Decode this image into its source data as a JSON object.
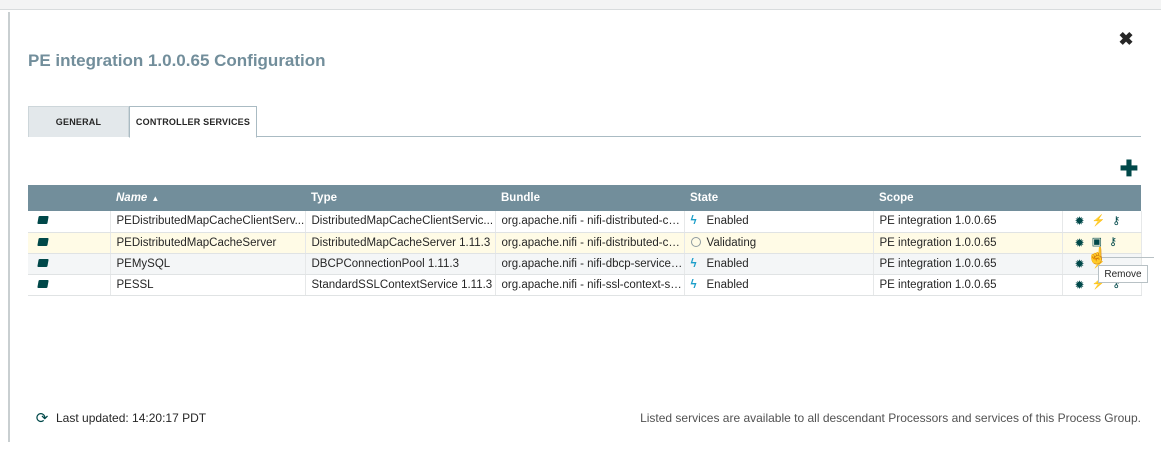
{
  "dialog": {
    "title": "PE integration 1.0.0.65 Configuration",
    "close_glyph": "✖"
  },
  "tabs": [
    {
      "label": "GENERAL",
      "active": false
    },
    {
      "label": "CONTROLLER SERVICES",
      "active": true
    }
  ],
  "add_glyph": "✚",
  "table": {
    "columns": [
      {
        "key": "name",
        "label": "Name",
        "sorted": "asc"
      },
      {
        "key": "type",
        "label": "Type"
      },
      {
        "key": "bundle",
        "label": "Bundle"
      },
      {
        "key": "state",
        "label": "State"
      },
      {
        "key": "scope",
        "label": "Scope"
      }
    ],
    "rows": [
      {
        "name": "PEDistributedMapCacheClientServ...",
        "type": "DistributedMapCacheClientServic...",
        "bundle": "org.apache.nifi - nifi-distributed-ca...",
        "state": "Enabled",
        "state_icon": "lightning-icon",
        "scope": "PE integration 1.0.0.65"
      },
      {
        "name": "PEDistributedMapCacheServer",
        "type": "DistributedMapCacheServer 1.11.3",
        "bundle": "org.apache.nifi - nifi-distributed-ca...",
        "state": "Validating",
        "state_icon": "validating-icon",
        "scope": "PE integration 1.0.0.65"
      },
      {
        "name": "PEMySQL",
        "type": "DBCPConnectionPool 1.11.3",
        "bundle": "org.apache.nifi - nifi-dbcp-service-...",
        "state": "Enabled",
        "state_icon": "lightning-icon",
        "scope": "PE integration 1.0.0.65"
      },
      {
        "name": "PESSL",
        "type": "StandardSSLContextService 1.11.3",
        "bundle": "org.apache.nifi - nifi-ssl-context-se...",
        "state": "Enabled",
        "state_icon": "lightning-icon",
        "scope": "PE integration 1.0.0.65"
      }
    ]
  },
  "tooltip": "Remove",
  "footer": {
    "last_updated": "Last updated: 14:20:17 PDT",
    "note": "Listed services are available to all descendant Processors and services of this Process Group."
  },
  "colors": {
    "header_bg": "#728e9b",
    "accent": "#004849",
    "highlight_row": "#fffbe6"
  }
}
